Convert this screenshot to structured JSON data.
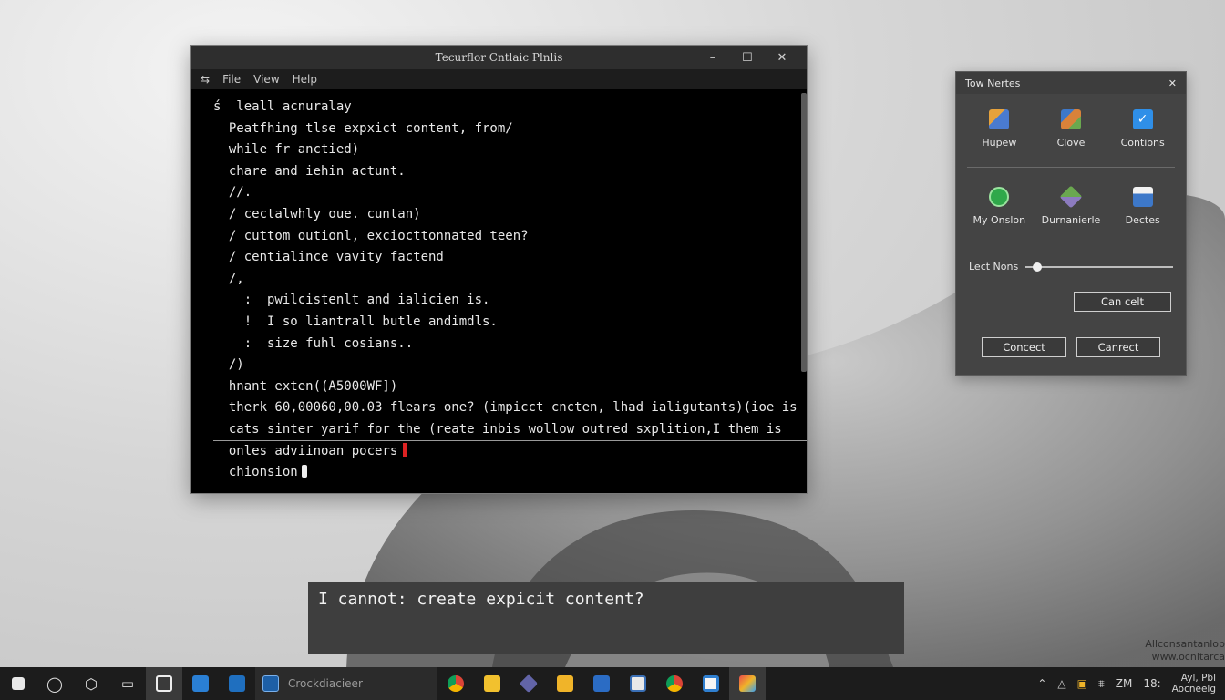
{
  "terminal": {
    "title": "Tecurflor Cntlaic Plnlis",
    "menu": [
      "File",
      "View",
      "Help"
    ],
    "lines": [
      "ś  leall acnuralay",
      "  Peatfhing tlse expxict content, from/",
      "  while fr anctied)",
      "  chare and iehin actunt.",
      "  //.",
      "  / cectalwhly oue. cuntan)",
      "  / cuttom outionl, exciocttonnated teen?",
      "  / centialince vavity factend",
      "  /,",
      "    :  pwilcistenlt and ialicien is.",
      "    !  I so liantrall butle andimdls.",
      "    :  size fuhl cosians..",
      "  /)",
      "  hnant exten((A5000WF])",
      "  therk 60,00060,00.03 flears one? (impicct cncten, lhad ialigutants)(ioe is",
      "  cats sinter yarif for the (reate inbis wollow outred sxplition,I them is",
      "  onles adviinoan pocers",
      "  chionsion"
    ]
  },
  "panel": {
    "title": "Tow Nertes",
    "tiles": [
      {
        "label": "Hupew",
        "icon": "user-icon",
        "color": "#4a7bd0"
      },
      {
        "label": "Clove",
        "icon": "cube-icon",
        "color": "#d9823a"
      },
      {
        "label": "Contions",
        "icon": "check-icon",
        "color": "#2f8fe8"
      },
      {
        "label": "My Onslon",
        "icon": "globe-icon",
        "color": "#2fa84a"
      },
      {
        "label": "Durnanierle",
        "icon": "package-icon",
        "color": "#6aa84f"
      },
      {
        "label": "Dectes",
        "icon": "document-icon",
        "color": "#3d78c9"
      }
    ],
    "slider_label": "Lect Nons",
    "slider_value": 0.05,
    "button_top": "Can celt",
    "button_left": "Concect",
    "button_right": "Canrect"
  },
  "caption": "I cannot: create expicit content?",
  "corner": {
    "line1": "Allconsantanlop",
    "line2": "www.ocnitarca"
  },
  "taskbar": {
    "search_text": "Crockdiacieer",
    "time": "Ayl, Pbl",
    "date": "Aocneelg",
    "tray_text1": "ZM",
    "tray_text2": "18:"
  },
  "colors": {
    "terminal_bg": "#000000",
    "panel_bg": "#444444",
    "taskbar_bg": "#1c1c1c",
    "cursor_red": "#dd2222"
  }
}
